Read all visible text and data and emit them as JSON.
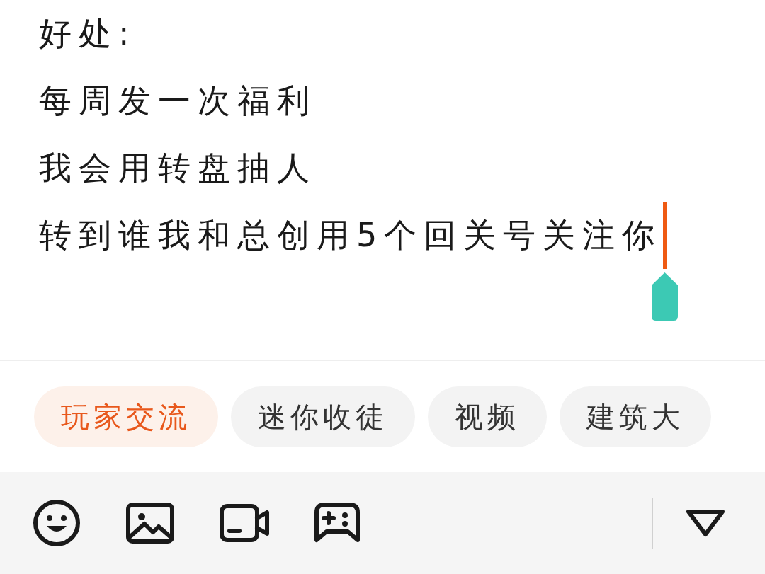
{
  "editor": {
    "lines": [
      "好处:",
      "每周发一次福利",
      "我会用转盘抽人",
      "转到谁我和总创用5个回关号关注你"
    ]
  },
  "tags": [
    {
      "label": "玩家交流",
      "selected": true
    },
    {
      "label": "迷你收徒",
      "selected": false
    },
    {
      "label": "视频",
      "selected": false
    },
    {
      "label": "建筑大",
      "selected": false
    }
  ],
  "toolbar": [
    {
      "kind": "emoji"
    },
    {
      "kind": "image"
    },
    {
      "kind": "video"
    },
    {
      "kind": "game"
    },
    {
      "kind": "collapse"
    }
  ]
}
